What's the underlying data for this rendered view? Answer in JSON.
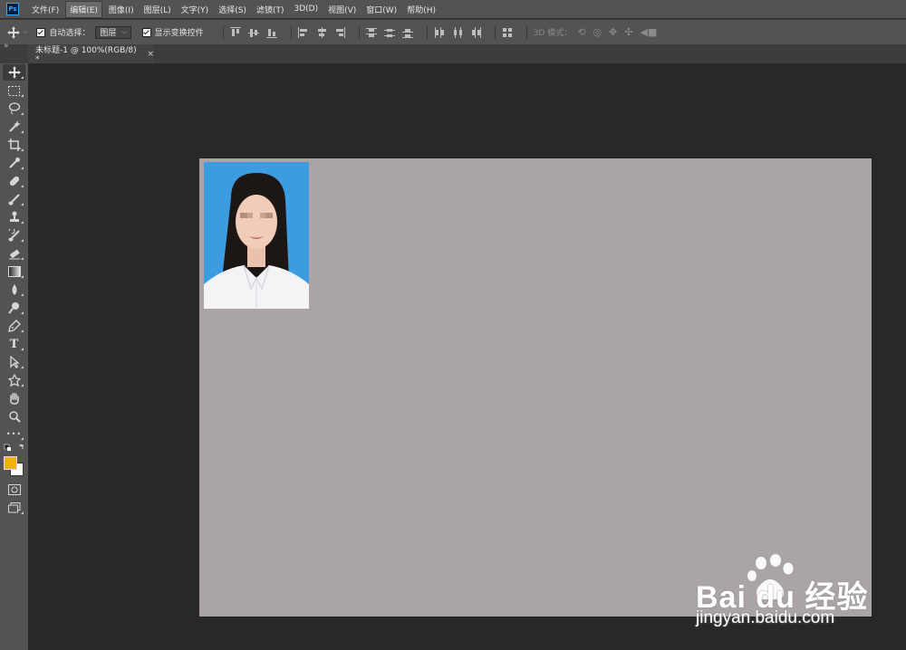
{
  "app": {
    "logo_text": "Ps"
  },
  "menu": [
    {
      "label": "文件(F)"
    },
    {
      "label": "编辑(E)",
      "active": true
    },
    {
      "label": "图像(I)"
    },
    {
      "label": "图层(L)"
    },
    {
      "label": "文字(Y)"
    },
    {
      "label": "选择(S)"
    },
    {
      "label": "滤镜(T)"
    },
    {
      "label": "3D(D)"
    },
    {
      "label": "视图(V)"
    },
    {
      "label": "窗口(W)"
    },
    {
      "label": "帮助(H)"
    }
  ],
  "options_bar": {
    "auto_select_label": "自动选择：",
    "auto_select_checked": true,
    "auto_select_target": "图层",
    "show_transform_label": "显示变换控件",
    "show_transform_checked": true,
    "mode_3d_label": "3D 模式："
  },
  "document_tab": {
    "title": "未标题-1 @ 100%(RGB/8) *",
    "close_glyph": "×"
  },
  "toolbar": {
    "more_glyph": "•••",
    "foreground_color": "#f0b400",
    "background_color": "#ffffff"
  },
  "canvas": {
    "background_color": "#aba4a4",
    "photo_background_color": "#3d9be0"
  },
  "watermark": {
    "brand": "Bai du 经验",
    "url": "jingyan.baidu.com"
  }
}
